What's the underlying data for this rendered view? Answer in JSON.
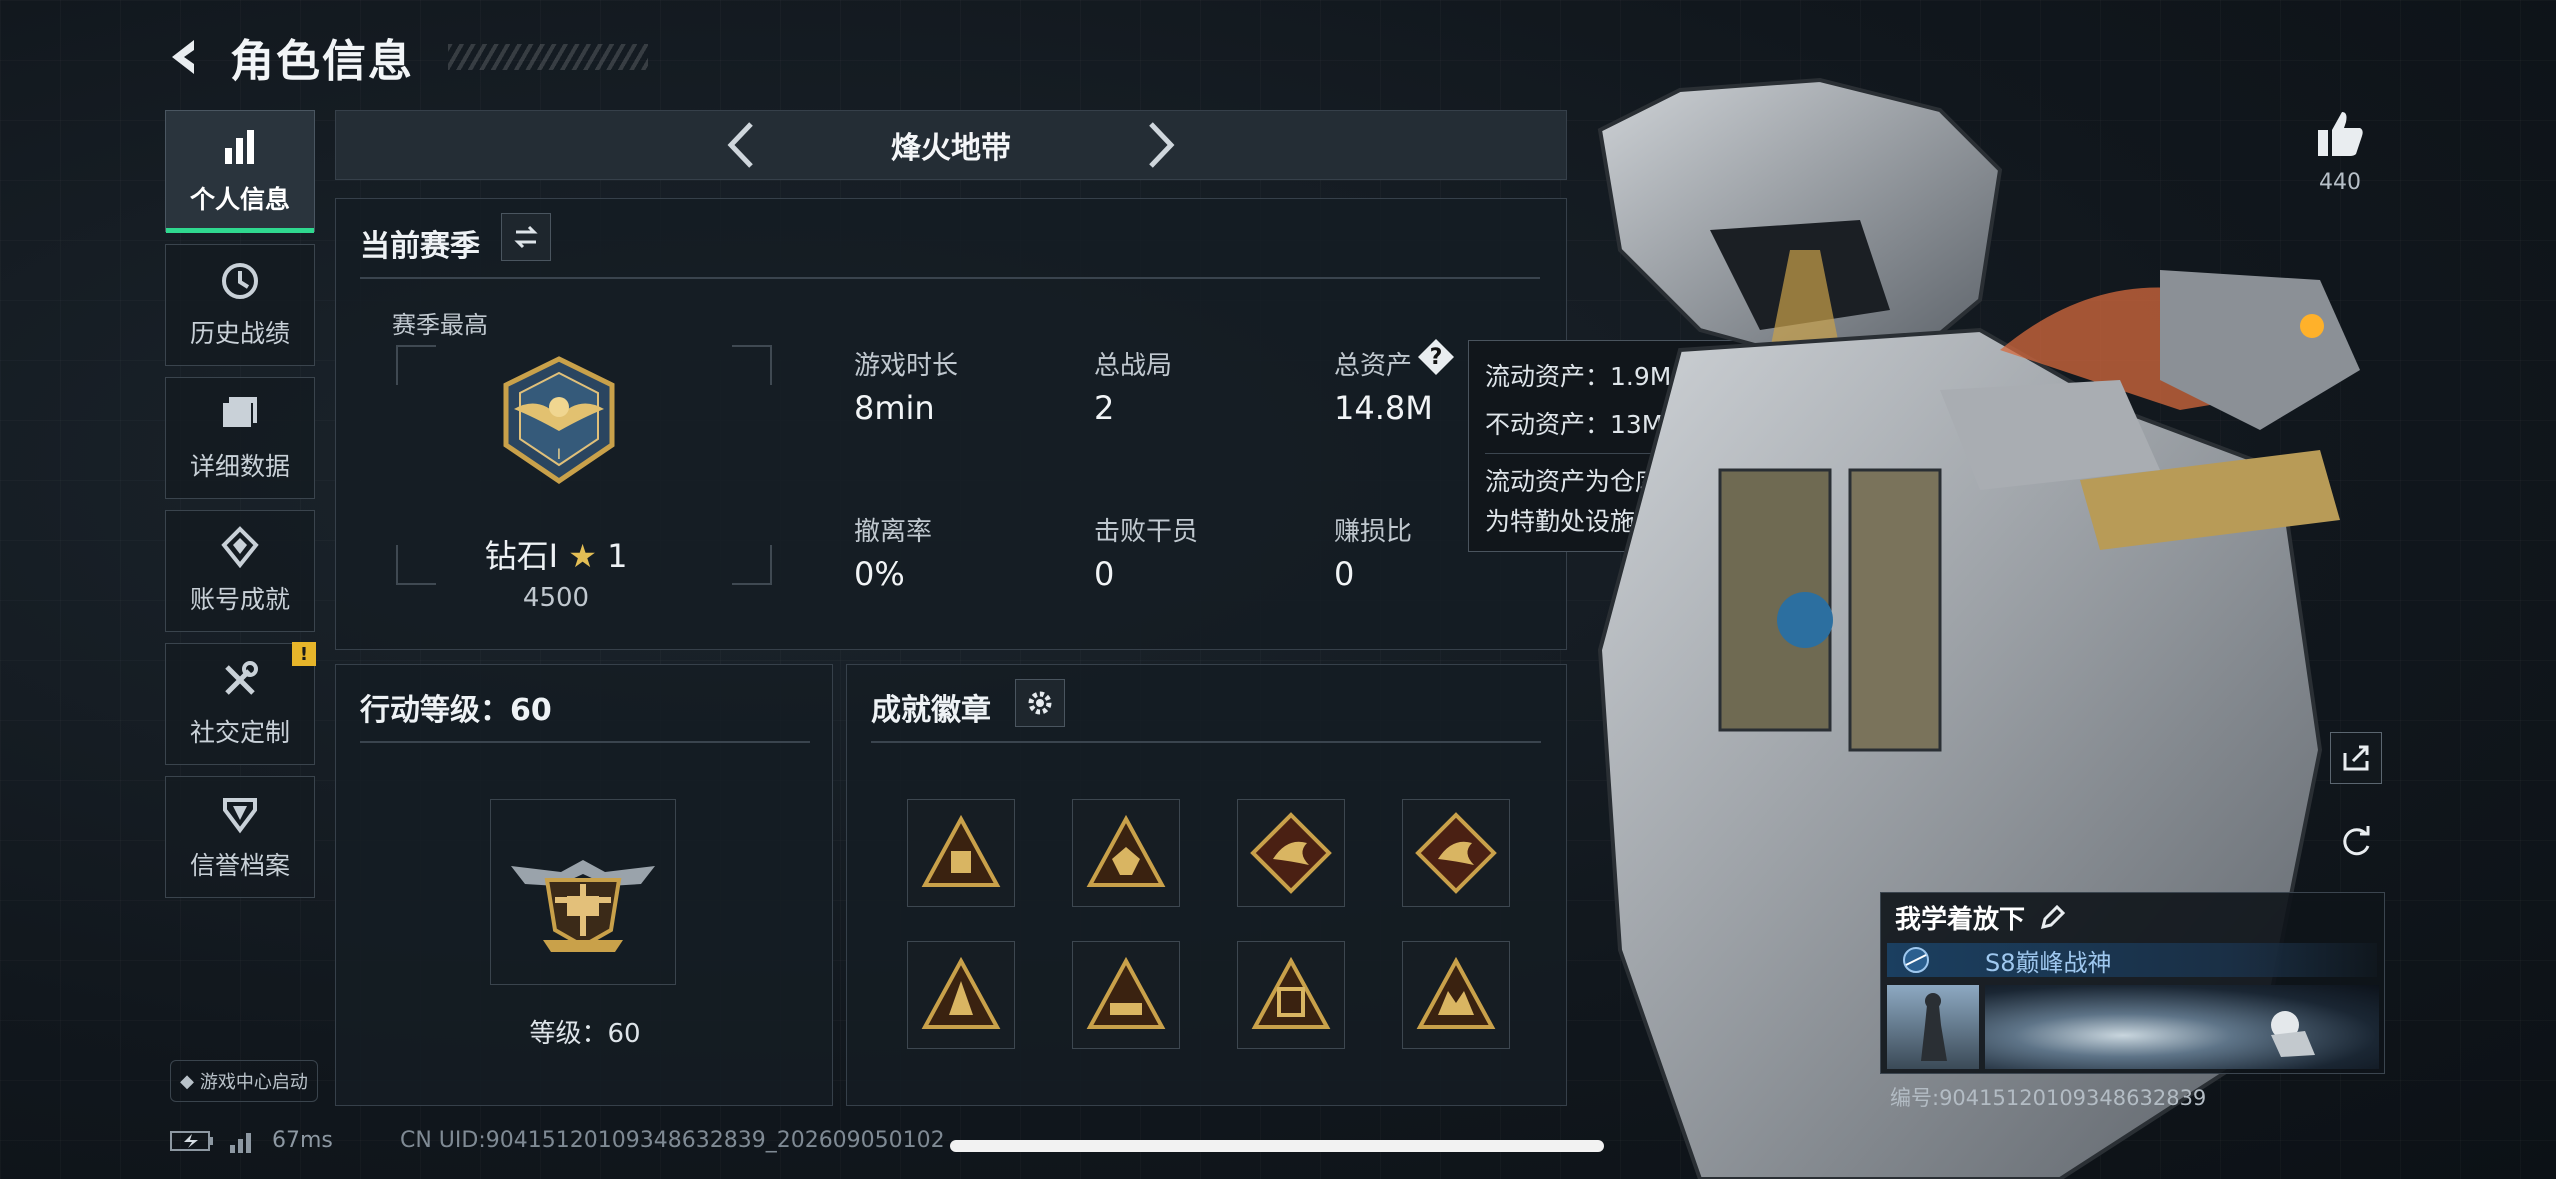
{
  "header": {
    "title": "角色信息"
  },
  "sidebar": {
    "items": [
      {
        "label": "个人信息",
        "icon": "bar-chart-icon",
        "active": true
      },
      {
        "label": "历史战绩",
        "icon": "history-clock-icon"
      },
      {
        "label": "详细数据",
        "icon": "folder-icon"
      },
      {
        "label": "账号成就",
        "icon": "achievement-icon"
      },
      {
        "label": "社交定制",
        "icon": "tools-icon",
        "alert": "!"
      },
      {
        "label": "信誉档案",
        "icon": "shield-icon"
      }
    ],
    "launch_label": "游戏中心启动"
  },
  "mode_bar": {
    "name": "烽火地带"
  },
  "season": {
    "title": "当前赛季",
    "best_label": "赛季最高",
    "rank_name": "钻石I",
    "rank_stars": "1",
    "rank_points": "4500",
    "stats": [
      {
        "label": "游戏时长",
        "value": "8min"
      },
      {
        "label": "总战局",
        "value": "2"
      },
      {
        "label": "总资产",
        "value": "14.8M"
      },
      {
        "label": "撤离率",
        "value": "0%"
      },
      {
        "label": "击败干员",
        "value": "0"
      },
      {
        "label": "赚损比",
        "value": "0"
      }
    ]
  },
  "tooltip": {
    "liquid": "流动资产：1.9M",
    "fixed": "不动资产：13M",
    "desc_line1": "流动资产为仓库资产和哈夫币，不动资产",
    "desc_line2": "为特勤处设施和收藏室设施"
  },
  "level": {
    "title": "行动等级：60",
    "level_text": "等级：60"
  },
  "achievements": {
    "title": "成就徽章"
  },
  "likes": {
    "count": "440"
  },
  "card": {
    "name": "我学着放下",
    "badge": "S8巅峰战神",
    "id": "编号:904151201093486328​39"
  },
  "status": {
    "ping": "67ms",
    "uid": "CN UID:9041512010934863283​9_202609050102"
  },
  "colors": {
    "accent": "#2fd88f",
    "warning": "#e7b52a",
    "gold": "#c9a14a"
  }
}
